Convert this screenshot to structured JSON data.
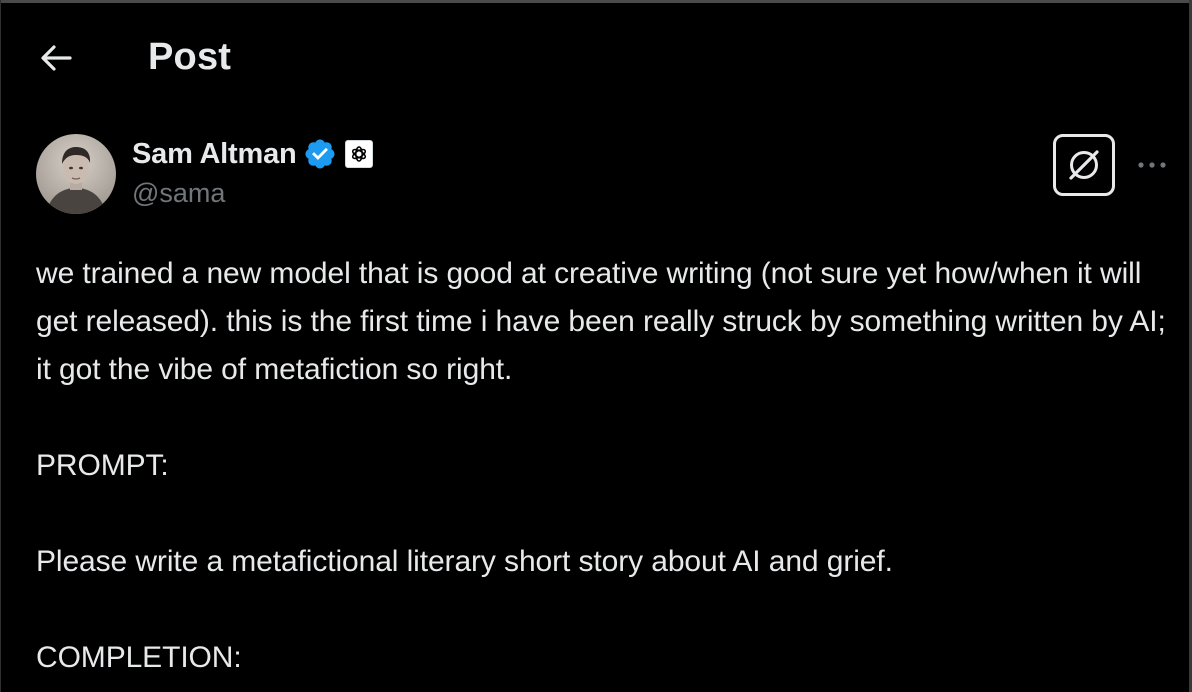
{
  "header": {
    "title": "Post",
    "back_icon": "arrow-left-icon"
  },
  "author": {
    "name": "Sam Altman",
    "handle": "@sama",
    "verified_icon": "verified-badge-icon",
    "affiliate_icon": "openai-logo-icon",
    "verified_color": "#1d9bf0"
  },
  "actions": {
    "grok_icon": "grok-icon",
    "more_icon": "more-dots-icon"
  },
  "post": {
    "paragraphs": [
      "we trained a new model that is good at creative writing (not sure yet how/when it will get released). this is the first time i have been really struck by something written by AI; it got the vibe of metafiction so right.",
      "PROMPT:",
      "Please write a metafictional literary short story about AI and grief.",
      "COMPLETION:"
    ]
  },
  "colors": {
    "background": "#000000",
    "text_primary": "#e7e9ea",
    "text_secondary": "#71767b"
  }
}
